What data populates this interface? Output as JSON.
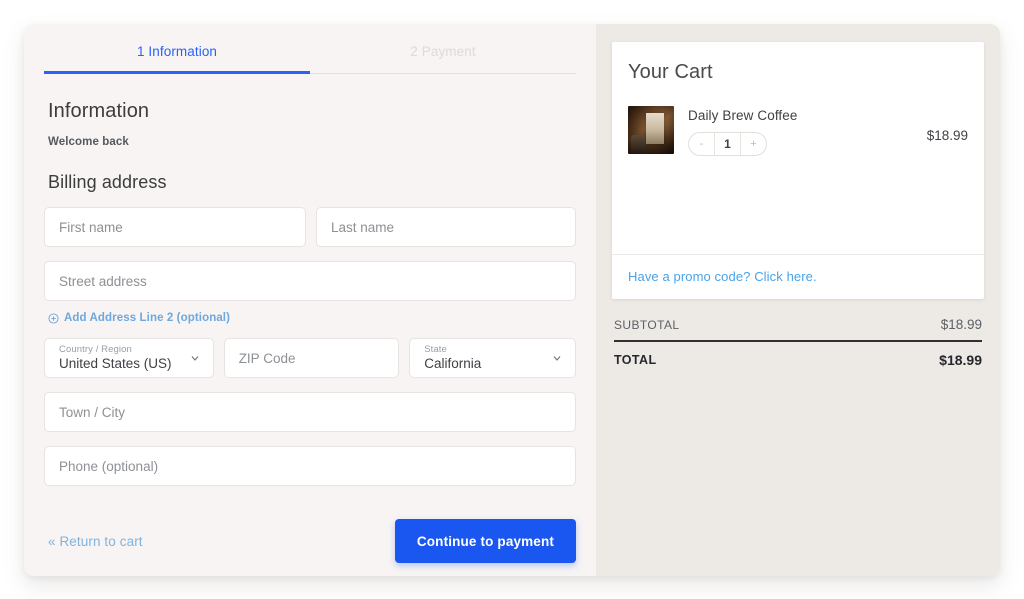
{
  "tabs": [
    {
      "label": "1 Information",
      "state": "active"
    },
    {
      "label": "2 Payment",
      "state": "inactive"
    }
  ],
  "information": {
    "heading": "Information",
    "welcome": "Welcome back",
    "billing_heading": "Billing address"
  },
  "fields": {
    "first_name_placeholder": "First name",
    "last_name_placeholder": "Last name",
    "street_placeholder": "Street address",
    "add_line2_label": "Add Address Line 2 (optional)",
    "country_label": "Country / Region",
    "country_value": "United States (US)",
    "zip_placeholder": "ZIP Code",
    "state_label": "State",
    "state_value": "California",
    "city_placeholder": "Town / City",
    "phone_placeholder": "Phone (optional)"
  },
  "actions": {
    "return_label": "« Return to cart",
    "continue_label": "Continue to payment"
  },
  "cart": {
    "title": "Your Cart",
    "items": [
      {
        "name": "Daily Brew Coffee",
        "quantity": "1",
        "price": "$18.99",
        "decrement_label": "-",
        "increment_label": "+"
      }
    ],
    "promo_label": "Have a promo code? Click here.",
    "subtotal_label": "SUBTOTAL",
    "subtotal_value": "$18.99",
    "total_label": "TOTAL",
    "total_value": "$18.99"
  },
  "colors": {
    "accent_blue": "#1a56f0",
    "tab_active": "#2962f6",
    "link_blue": "#4aa3e8",
    "panel_left_bg": "#f7f4f3",
    "panel_right_bg": "#edeae6"
  }
}
